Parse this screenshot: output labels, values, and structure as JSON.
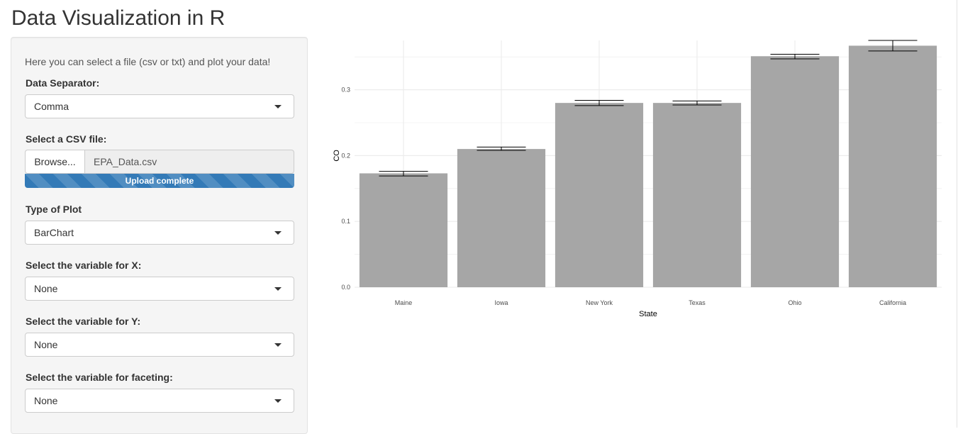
{
  "app": {
    "title": "Data Visualization in R"
  },
  "sidebar": {
    "intro": "Here you can select a file (csv or txt) and plot your data!",
    "separator": {
      "label": "Data Separator:",
      "selected": "Comma"
    },
    "file": {
      "label": "Select a CSV file:",
      "browse_label": "Browse...",
      "file_name": "EPA_Data.csv",
      "progress_text": "Upload complete",
      "progress": 1.0
    },
    "plot_type": {
      "label": "Type of Plot",
      "selected": "BarChart"
    },
    "x_var": {
      "label": "Select the variable for X:",
      "selected": "None"
    },
    "y_var": {
      "label": "Select the variable for Y:",
      "selected": "None"
    },
    "facet_var": {
      "label": "Select the variable for faceting:",
      "selected": "None"
    }
  },
  "colors": {
    "bar_fill": "#a6a6a6",
    "grid": "#ebebeb",
    "progress_bar": "#337ab7"
  },
  "chart_data": {
    "type": "bar",
    "categories": [
      "Maine",
      "Iowa",
      "New York",
      "Texas",
      "Ohio",
      "California"
    ],
    "values": [
      0.173,
      0.21,
      0.28,
      0.28,
      0.351,
      0.367
    ],
    "error_low": [
      0.169,
      0.208,
      0.276,
      0.277,
      0.347,
      0.359
    ],
    "error_high": [
      0.176,
      0.213,
      0.284,
      0.283,
      0.354,
      0.375
    ],
    "yticks": [
      "0.0",
      "0.1",
      "0.2",
      "0.3"
    ],
    "ytick_values": [
      0.0,
      0.1,
      0.2,
      0.3
    ],
    "xlabel": "State",
    "ylabel": "CO",
    "ylim": [
      0,
      0.375
    ],
    "grid": true
  }
}
